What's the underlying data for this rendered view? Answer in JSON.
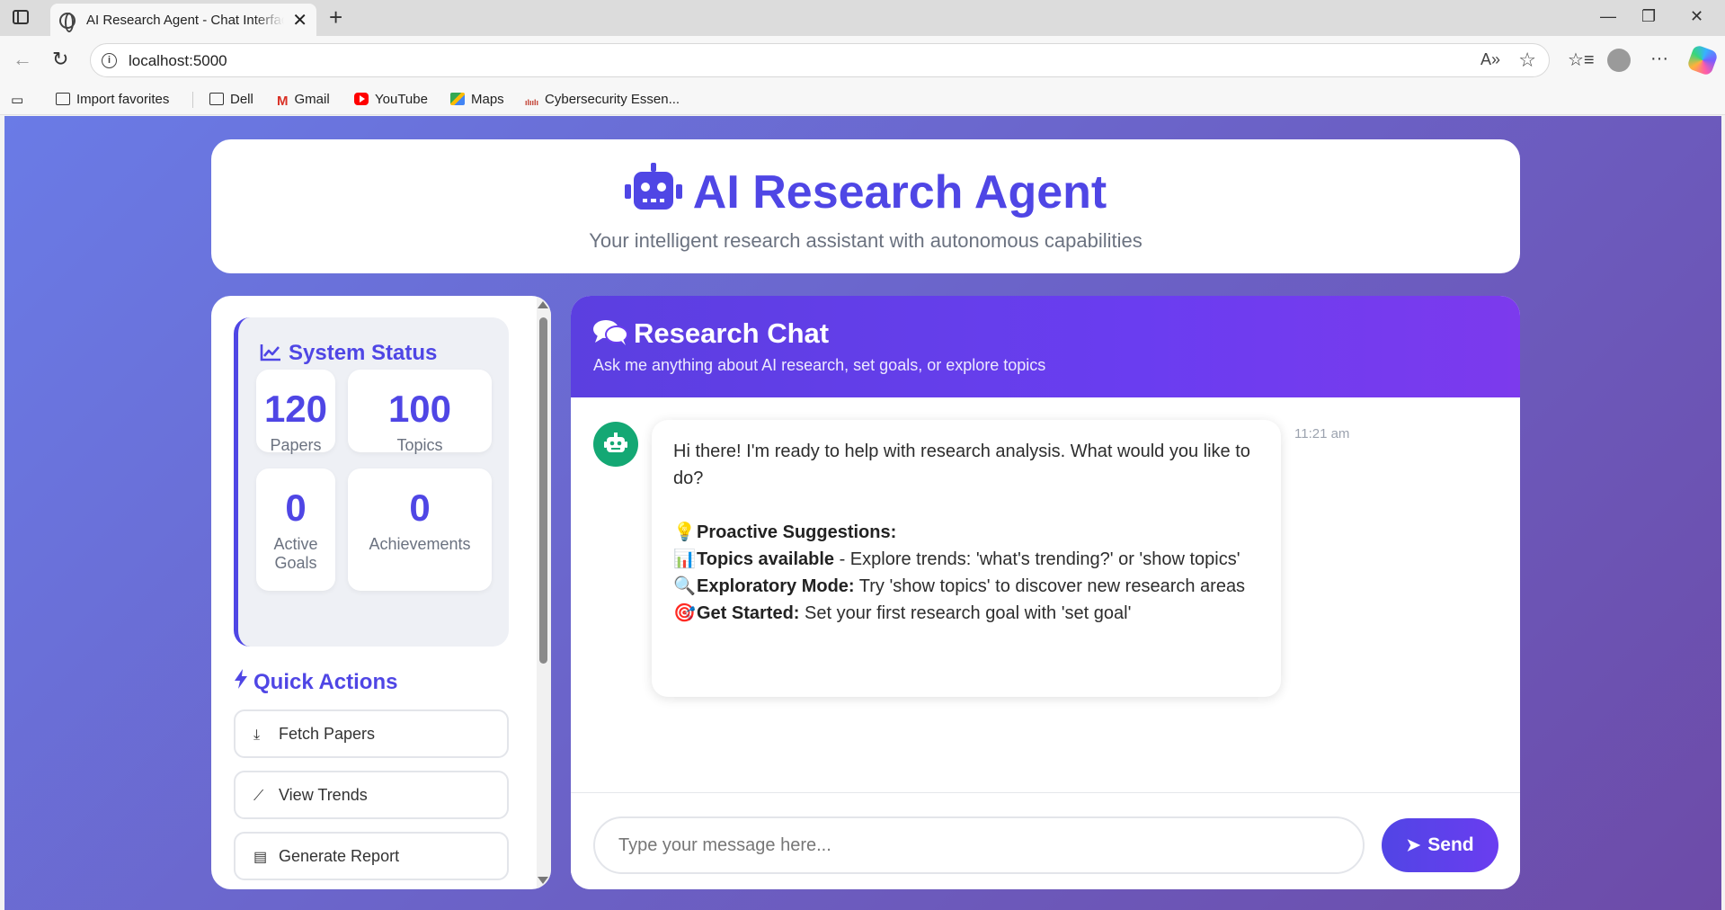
{
  "browser": {
    "tab_title": "AI Research Agent - Chat Interface",
    "tab_close": "✕",
    "new_tab": "+",
    "url": "localhost:5000",
    "window_controls": {
      "minimize": "—",
      "restore": "❐",
      "close": "✕"
    },
    "bookmarks": [
      {
        "label": "Import favorites",
        "icon": "import-icon"
      },
      {
        "label": "Dell",
        "icon": "folder-icon"
      },
      {
        "label": "Gmail",
        "icon": "gmail-icon"
      },
      {
        "label": "YouTube",
        "icon": "youtube-icon"
      },
      {
        "label": "Maps",
        "icon": "maps-icon"
      },
      {
        "label": "Cybersecurity Essen...",
        "icon": "cisco-icon"
      }
    ]
  },
  "hero": {
    "title": "AI Research Agent",
    "subtitle": "Your intelligent research assistant with autonomous capabilities"
  },
  "system_status": {
    "title": "System Status",
    "stats": [
      {
        "value": "120",
        "label": "Papers"
      },
      {
        "value": "100",
        "label": "Topics"
      },
      {
        "value": "0",
        "label": "Active Goals"
      },
      {
        "value": "0",
        "label": "Achievements"
      }
    ]
  },
  "quick_actions": {
    "title": "Quick Actions",
    "buttons": [
      {
        "label": "Fetch Papers",
        "icon": "download-icon"
      },
      {
        "label": "View Trends",
        "icon": "chart-line-icon"
      },
      {
        "label": "Generate Report",
        "icon": "file-icon"
      }
    ]
  },
  "chat": {
    "title": "Research Chat",
    "subtitle": "Ask me anything about AI research, set goals, or explore topics",
    "message": {
      "time": "11:21 am",
      "intro": "Hi there! I'm ready to help with research analysis. What would you like to do?",
      "suggestions_emoji": "💡",
      "suggestions_heading": "Proactive Suggestions:",
      "items": [
        {
          "emoji": "📊",
          "bold": "Topics available",
          "text": " - Explore trends: 'what's trending?' or 'show topics'"
        },
        {
          "emoji": "🔍",
          "bold": "Exploratory Mode:",
          "text": " Try 'show topics' to discover new research areas"
        },
        {
          "emoji": "🎯",
          "bold": "Get Started:",
          "text": " Set your first research goal with 'set goal'"
        }
      ]
    },
    "input_placeholder": "Type your message here...",
    "send_label": "Send"
  },
  "colors": {
    "accent": "#4f46e5",
    "header_gradient_start": "#5b3fe0",
    "header_gradient_end": "#7c3aed",
    "bot_avatar": "#14a874"
  }
}
